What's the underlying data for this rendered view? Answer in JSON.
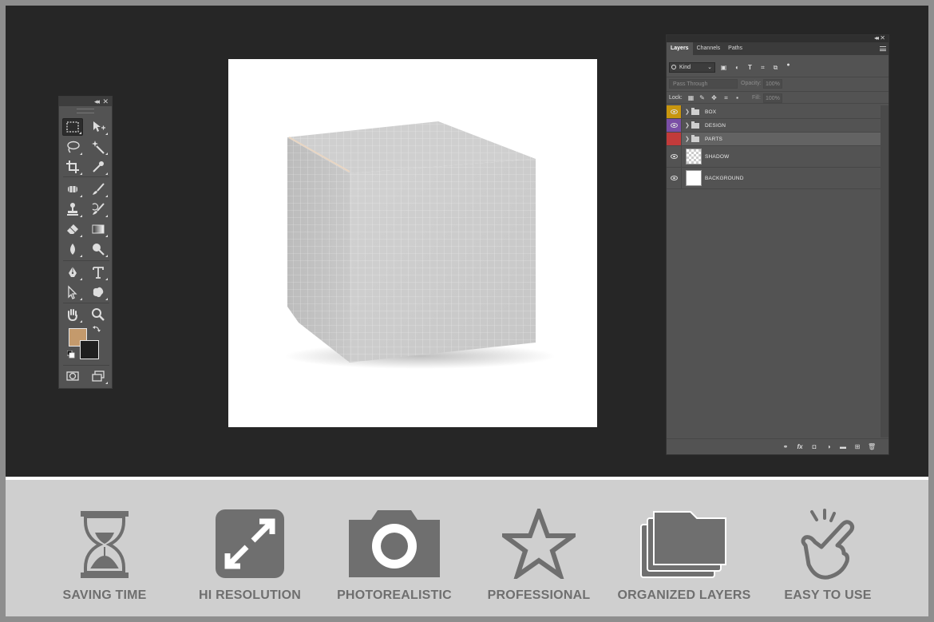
{
  "tools_panel": {
    "collapse_glyph": "◂◂",
    "close_glyph": "✕",
    "tools": [
      {
        "name": "rectangular-marquee-icon"
      },
      {
        "name": "move-icon"
      },
      {
        "name": "lasso-icon"
      },
      {
        "name": "magic-wand-icon"
      },
      {
        "name": "crop-icon"
      },
      {
        "name": "eyedropper-icon"
      },
      {
        "name": "spot-healing-icon"
      },
      {
        "name": "brush-icon"
      },
      {
        "name": "clone-stamp-icon"
      },
      {
        "name": "history-brush-icon"
      },
      {
        "name": "eraser-icon"
      },
      {
        "name": "gradient-icon"
      },
      {
        "name": "blur-icon"
      },
      {
        "name": "dodge-icon"
      },
      {
        "name": "pen-icon"
      },
      {
        "name": "type-icon"
      },
      {
        "name": "path-selection-icon"
      },
      {
        "name": "custom-shape-icon"
      },
      {
        "name": "hand-icon"
      },
      {
        "name": "zoom-icon"
      }
    ],
    "foreground_color": "#c49a6c",
    "background_color": "#1f1f1f"
  },
  "layers_panel": {
    "collapse_glyph": "◂◂",
    "close_glyph": "✕",
    "tabs": [
      "Layers",
      "Channels",
      "Paths"
    ],
    "kind_label": "Kind",
    "blend_mode": "Pass Through",
    "opacity_label": "Opacity:",
    "opacity_value": "100%",
    "lock_label": "Lock:",
    "fill_label": "Fill:",
    "fill_value": "100%",
    "layers": [
      {
        "name": "BOX",
        "type": "group",
        "color": "#c8960e"
      },
      {
        "name": "DESIGN",
        "type": "group",
        "color": "#7a4ea6"
      },
      {
        "name": "PARTS",
        "type": "group",
        "color": "#c23b3b",
        "selected": true,
        "hidden": true
      },
      {
        "name": "SHADOW",
        "type": "layer"
      },
      {
        "name": "BACKGROUND",
        "type": "layer"
      }
    ]
  },
  "features": [
    {
      "label": "SAVING TIME",
      "icon": "hourglass-icon"
    },
    {
      "label": "HI RESOLUTION",
      "icon": "expand-icon"
    },
    {
      "label": "PHOTOREALISTIC",
      "icon": "camera-icon"
    },
    {
      "label": "PROFESSIONAL",
      "icon": "star-icon"
    },
    {
      "label": "ORGANIZED LAYERS",
      "icon": "layers-folder-icon"
    },
    {
      "label": "EASY TO USE",
      "icon": "pointing-hand-icon"
    }
  ],
  "colors": {
    "workspace": "#262626",
    "panel": "#535353",
    "feature_icon": "#6f6f6f"
  }
}
